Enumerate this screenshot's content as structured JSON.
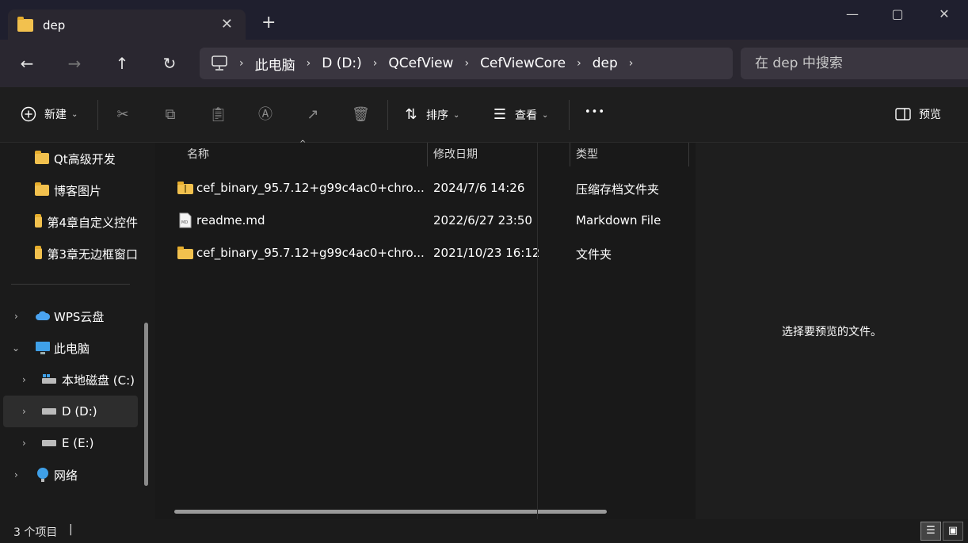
{
  "window": {
    "tab_title": "dep",
    "tab_close": "✕",
    "new_tab": "+",
    "minimize": "—",
    "maximize": "▢",
    "close": "✕"
  },
  "nav": {
    "back": "←",
    "forward": "→",
    "up": "↑",
    "refresh": "↻",
    "breadcrumbs": [
      "此电脑",
      "D (D:)",
      "QCefView",
      "CefViewCore",
      "dep"
    ],
    "search_placeholder": "在 dep 中搜索"
  },
  "toolbar": {
    "new_label": "新建",
    "sort_label": "排序",
    "view_label": "查看",
    "more": "•••",
    "preview_label": "预览"
  },
  "sidebar": {
    "folders": [
      "Qt高级开发",
      "博客图片",
      "第4章自定义控件",
      "第3章无边框窗口"
    ],
    "wps": "WPS云盘",
    "this_pc": "此电脑",
    "drives": [
      "本地磁盘 (C:)",
      "D (D:)",
      "E (E:)"
    ],
    "network": "网络",
    "selected": "D (D:)"
  },
  "columns": {
    "name": "名称",
    "modified": "修改日期",
    "type": "类型"
  },
  "files": [
    {
      "name": "cef_binary_95.7.12+g99c4ac0+chro...",
      "modified": "2024/7/6 14:26",
      "type": "压缩存档文件夹",
      "icon": "zip-folder-icon"
    },
    {
      "name": "readme.md",
      "modified": "2022/6/27 23:50",
      "type": "Markdown File",
      "icon": "markdown-file-icon"
    },
    {
      "name": "cef_binary_95.7.12+g99c4ac0+chro...",
      "modified": "2021/10/23 16:12",
      "type": "文件夹",
      "icon": "folder-icon"
    }
  ],
  "preview": {
    "message": "选择要预览的文件。"
  },
  "status": {
    "item_count": "3 个项目"
  },
  "colors": {
    "accent_folder": "#f2c14e",
    "background": "#191919",
    "titlebar": "#1f1f2e"
  }
}
